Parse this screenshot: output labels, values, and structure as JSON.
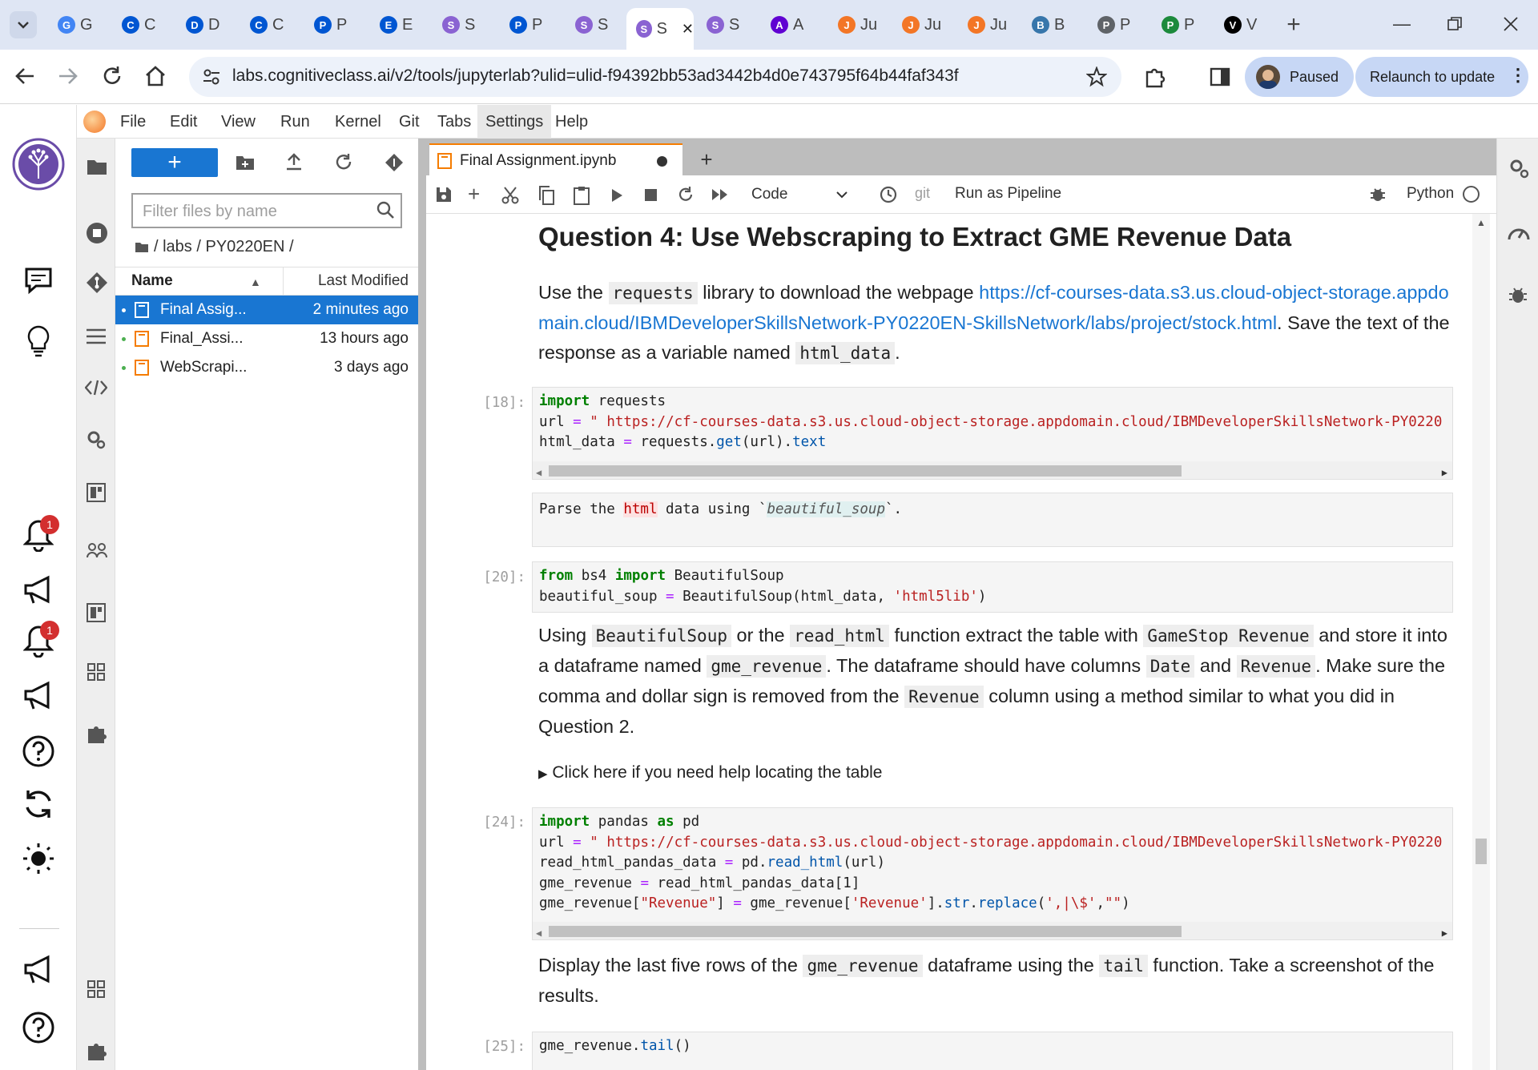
{
  "browser": {
    "tabs": [
      {
        "label": "G",
        "icon": "google-icon",
        "color": "#4285f4"
      },
      {
        "label": "C",
        "icon": "coursera-icon",
        "color": "#0056d2"
      },
      {
        "label": "D",
        "icon": "coursera-icon",
        "color": "#0056d2"
      },
      {
        "label": "C",
        "icon": "coursera-icon",
        "color": "#0056d2"
      },
      {
        "label": "P",
        "icon": "coursera-icon",
        "color": "#0056d2"
      },
      {
        "label": "E",
        "icon": "coursera-icon",
        "color": "#0056d2"
      },
      {
        "label": "S",
        "icon": "skillsnetwork-icon",
        "color": "#8a63d2"
      },
      {
        "label": "P",
        "icon": "coursera-icon",
        "color": "#0056d2"
      },
      {
        "label": "S",
        "icon": "skillsnetwork-icon",
        "color": "#8a63d2"
      },
      {
        "label": "S",
        "icon": "skillsnetwork-icon",
        "color": "#8a63d2"
      },
      {
        "label": "S",
        "icon": "skillsnetwork-icon",
        "color": "#8a63d2"
      },
      {
        "label": "A",
        "icon": "yahoo-icon",
        "color": "#6001d2"
      },
      {
        "label": "Ju",
        "icon": "jupyter-icon",
        "color": "#f37626"
      },
      {
        "label": "Ju",
        "icon": "jupyter-icon",
        "color": "#f37626"
      },
      {
        "label": "Ju",
        "icon": "jupyter-icon",
        "color": "#f37626"
      },
      {
        "label": "B",
        "icon": "python-icon",
        "color": "#3776ab"
      },
      {
        "label": "P",
        "icon": "globe-icon",
        "color": "#5f6368"
      },
      {
        "label": "P",
        "icon": "wp-icon",
        "color": "#1c8a3c"
      },
      {
        "label": "V",
        "icon": "wikipedia-icon",
        "color": "#000000"
      }
    ],
    "url": "labs.cognitiveclass.ai/v2/tools/jupyterlab?ulid=ulid-f94392bb53ad3442b4d0e743795f64b44faf343f",
    "profile_label": "Paused",
    "relaunch_label": "Relaunch to update"
  },
  "menubar": [
    "File",
    "Edit",
    "View",
    "Run",
    "Kernel",
    "Git",
    "Tabs",
    "Settings",
    "Help"
  ],
  "rail": {
    "badge_1": "1",
    "badge_2": "1"
  },
  "filebrowser": {
    "new_label": "+",
    "filter_placeholder": "Filter files by name",
    "breadcrumb": "/ labs / PY0220EN /",
    "col_name": "Name",
    "col_modified": "Last Modified",
    "files": [
      {
        "name": "Final Assig...",
        "modified": "2 minutes ago",
        "selected": true
      },
      {
        "name": "Final_Assi...",
        "modified": "13 hours ago",
        "selected": false
      },
      {
        "name": "WebScrapi...",
        "modified": "3 days ago",
        "selected": false
      }
    ]
  },
  "notebook": {
    "tab_title": "Final Assignment.ipynb",
    "cell_type": "Code",
    "git_label": "git",
    "pipeline_label": "Run as Pipeline",
    "kernel_label": "Python",
    "heading": "Question 4: Use Webscraping to Extract GME Revenue Data",
    "md1": {
      "pre": "Use the",
      "code1": "requests",
      "mid": "library to download the webpage",
      "link": "https://cf-courses-data.s3.us.cloud-object-storage.appdomain.cloud/IBMDeveloperSkillsNetwork-PY0220EN-SkillsNetwork/labs/project/stock.html",
      "post": ". Save the text of the response as a variable named",
      "code2": "html_data",
      "end": "."
    },
    "prompt_18": "[18]:",
    "code_18": [
      "import requests",
      "url = \" https://cf-courses-data.s3.us.cloud-object-storage.appdomain.cloud/IBMDeveloperSkillsNetwork-PY0220",
      "html_data = requests.get(url).text"
    ],
    "raw_md": "Parse the html data using `beautiful_soup`.",
    "prompt_20": "[20]:",
    "code_20": [
      "from bs4 import BeautifulSoup",
      "beautiful_soup = BeautifulSoup(html_data, 'html5lib')"
    ],
    "md2": {
      "t1": "Using",
      "c1": "BeautifulSoup",
      "t2": "or the",
      "c2": "read_html",
      "t3": "function extract the table with",
      "c3": "GameStop Revenue",
      "t4": "and store it into a dataframe named",
      "c4": "gme_revenue",
      "t5": ". The dataframe should have columns",
      "c5": "Date",
      "t6": "and",
      "c6": "Revenue",
      "t7": ". Make sure the comma and dollar sign is removed from the",
      "c7": "Revenue",
      "t8": "column using a method similar to what you did in Question 2."
    },
    "details_label": "Click here if you need help locating the table",
    "prompt_24": "[24]:",
    "code_24": [
      "import pandas as pd",
      "url = \" https://cf-courses-data.s3.us.cloud-object-storage.appdomain.cloud/IBMDeveloperSkillsNetwork-PY0220",
      "read_html_pandas_data = pd.read_html(url)",
      "gme_revenue = read_html_pandas_data[1]",
      "gme_revenue[\"Revenue\"] = gme_revenue['Revenue'].str.replace(',|\\$',\"\")"
    ],
    "md3": {
      "t1": "Display the last five rows of the",
      "c1": "gme_revenue",
      "t2": "dataframe using the",
      "c2": "tail",
      "t3": "function. Take a screenshot of the results."
    },
    "prompt_25": "[25]:",
    "code_25": "gme_revenue.tail()"
  },
  "colors": {
    "accent": "#1976d2",
    "jupyter_orange": "#f57c00",
    "tabstrip": "#dfe6f4"
  }
}
